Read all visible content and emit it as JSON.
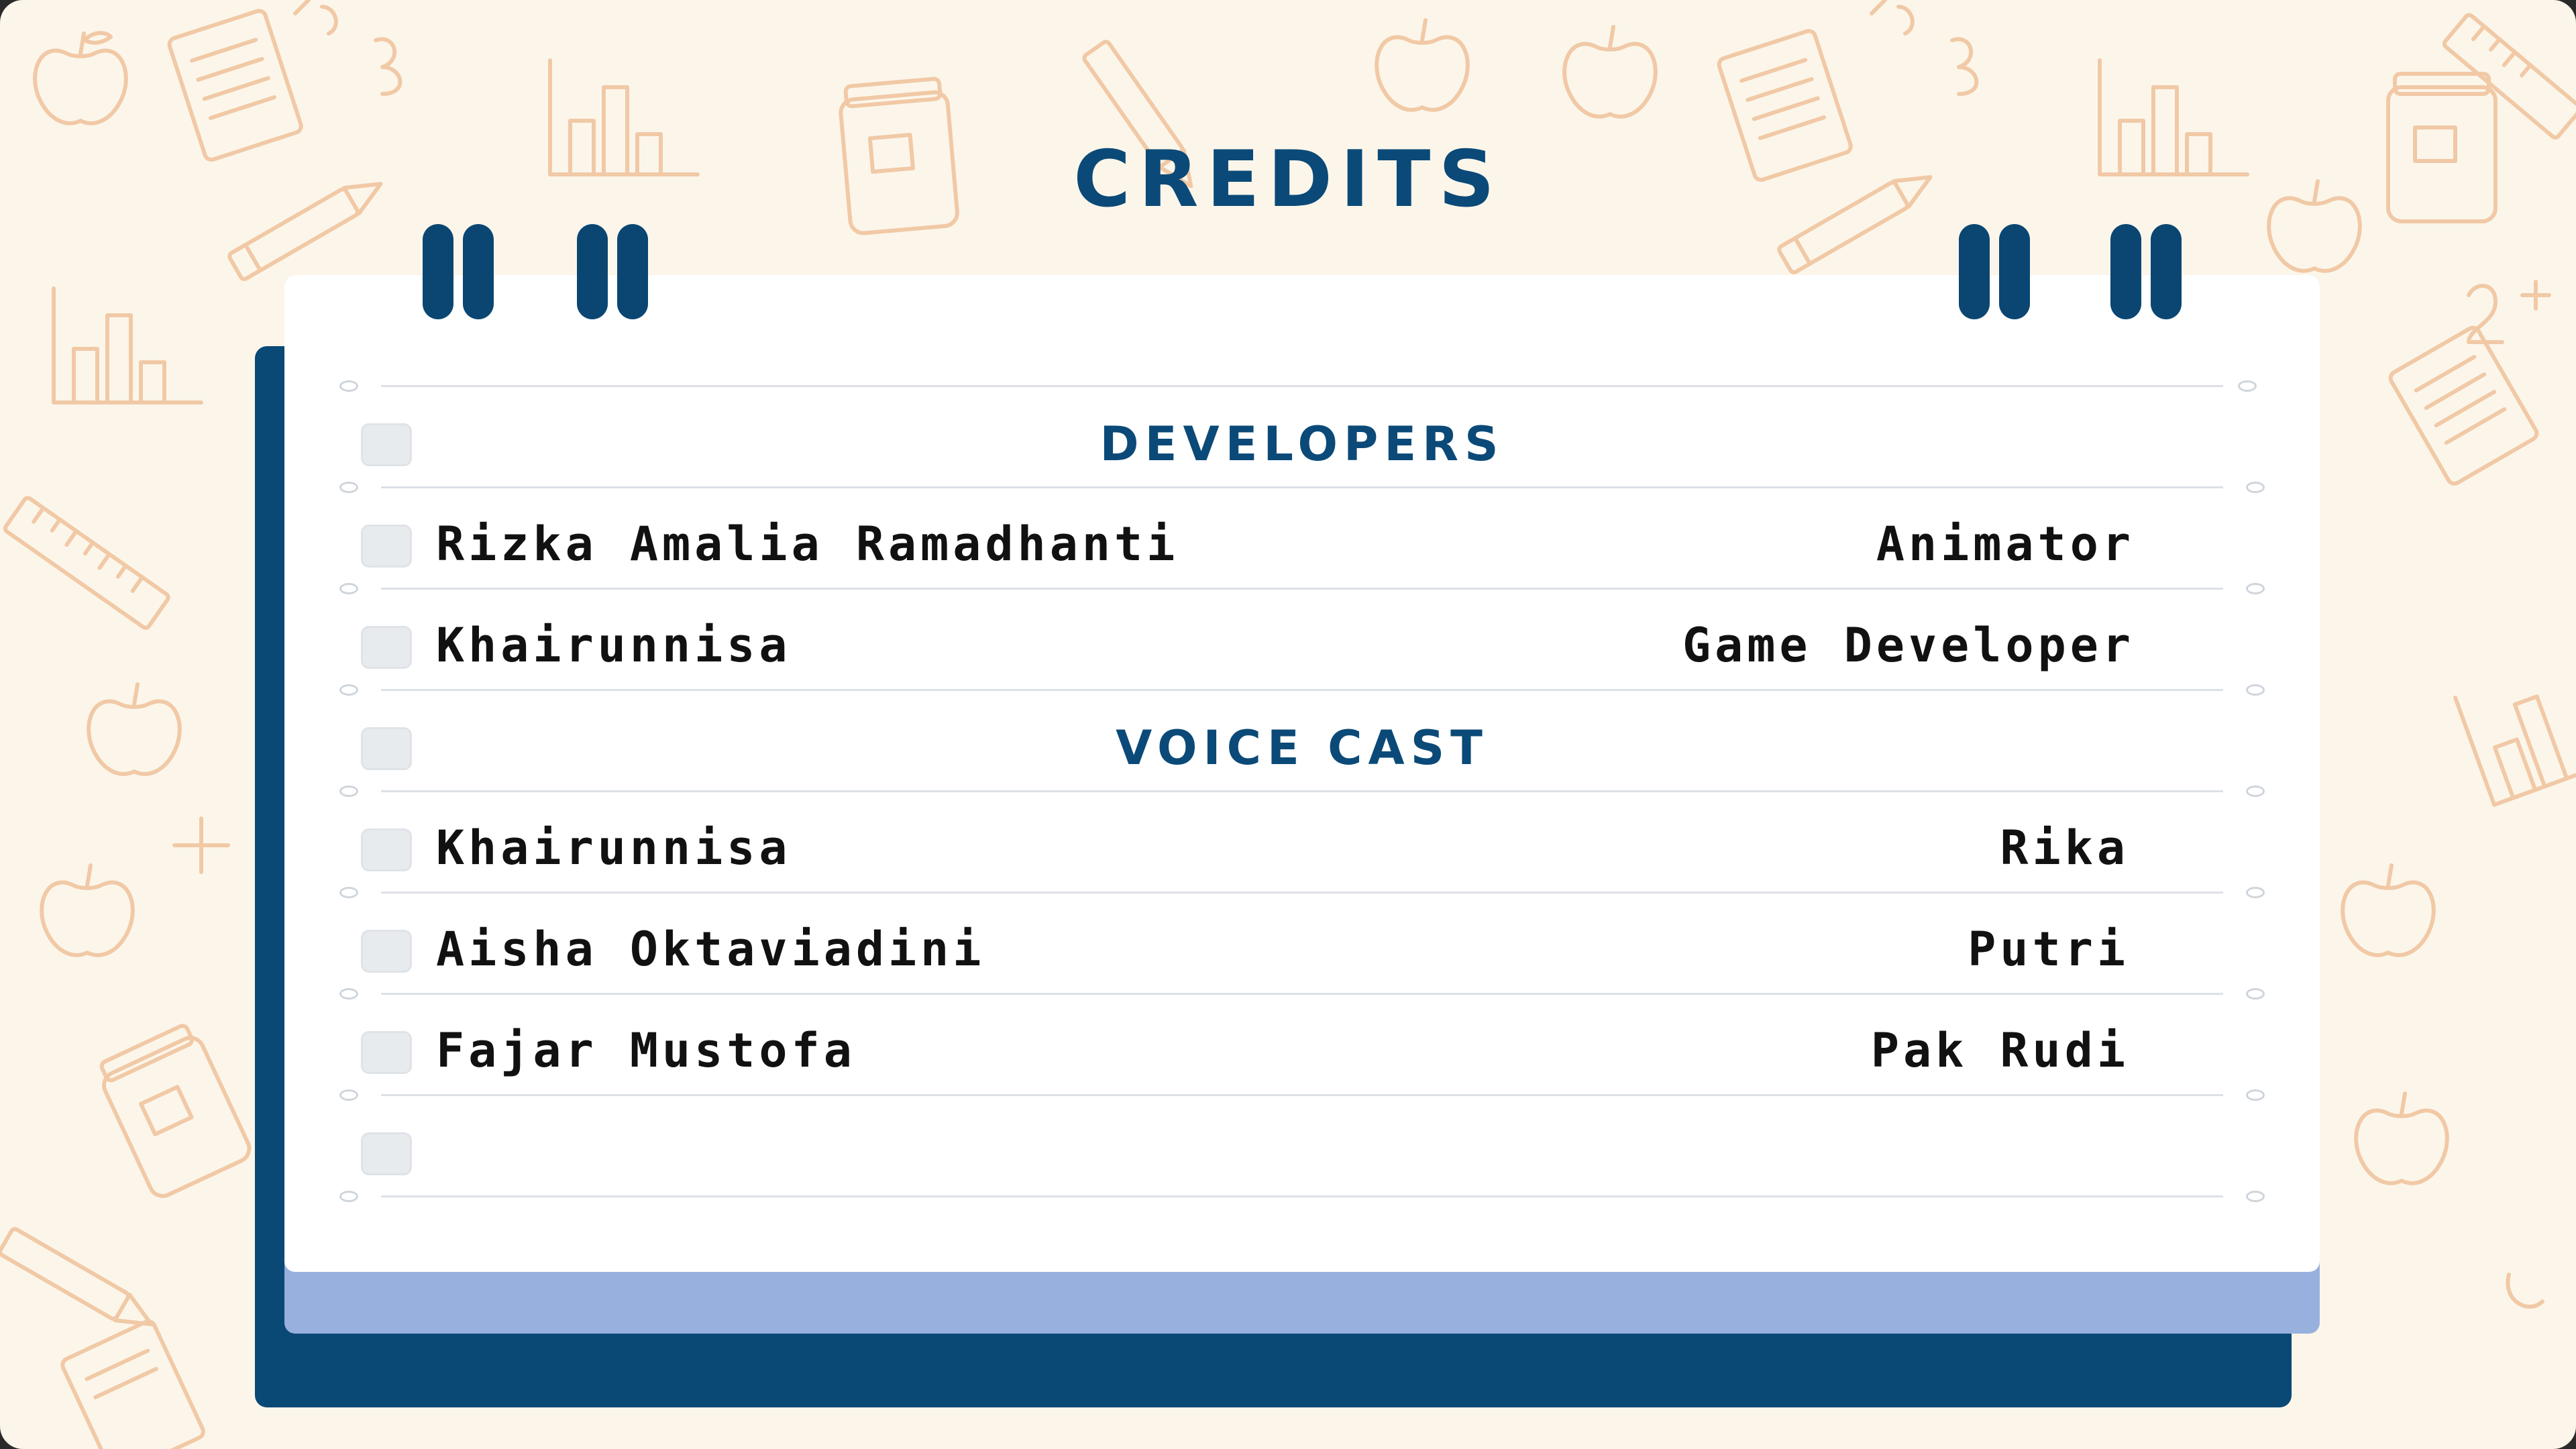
{
  "title": "CREDITS",
  "sections": [
    {
      "heading": "DEVELOPERS",
      "entries": [
        {
          "name": "Rizka Amalia Ramadhanti",
          "role": "Animator"
        },
        {
          "name": "Khairunnisa",
          "role": "Game Developer"
        }
      ]
    },
    {
      "heading": "VOICE CAST",
      "entries": [
        {
          "name": "Khairunnisa",
          "role": "Rika"
        },
        {
          "name": "Aisha Oktaviadini",
          "role": "Putri"
        },
        {
          "name": "Fajar Mustofa",
          "role": "Pak Rudi"
        }
      ]
    }
  ],
  "colors": {
    "background": "#fcf6ea",
    "doodle": "#f1c9a6",
    "accent_navy": "#0b4a78",
    "card": "#ffffff",
    "card_back": "#98b0de",
    "checkbox": "#e8ebee"
  },
  "icons": [
    "apple-icon",
    "notebook-icon",
    "pencil-icon",
    "bar-chart-icon",
    "ruler-icon",
    "jar-icon"
  ]
}
